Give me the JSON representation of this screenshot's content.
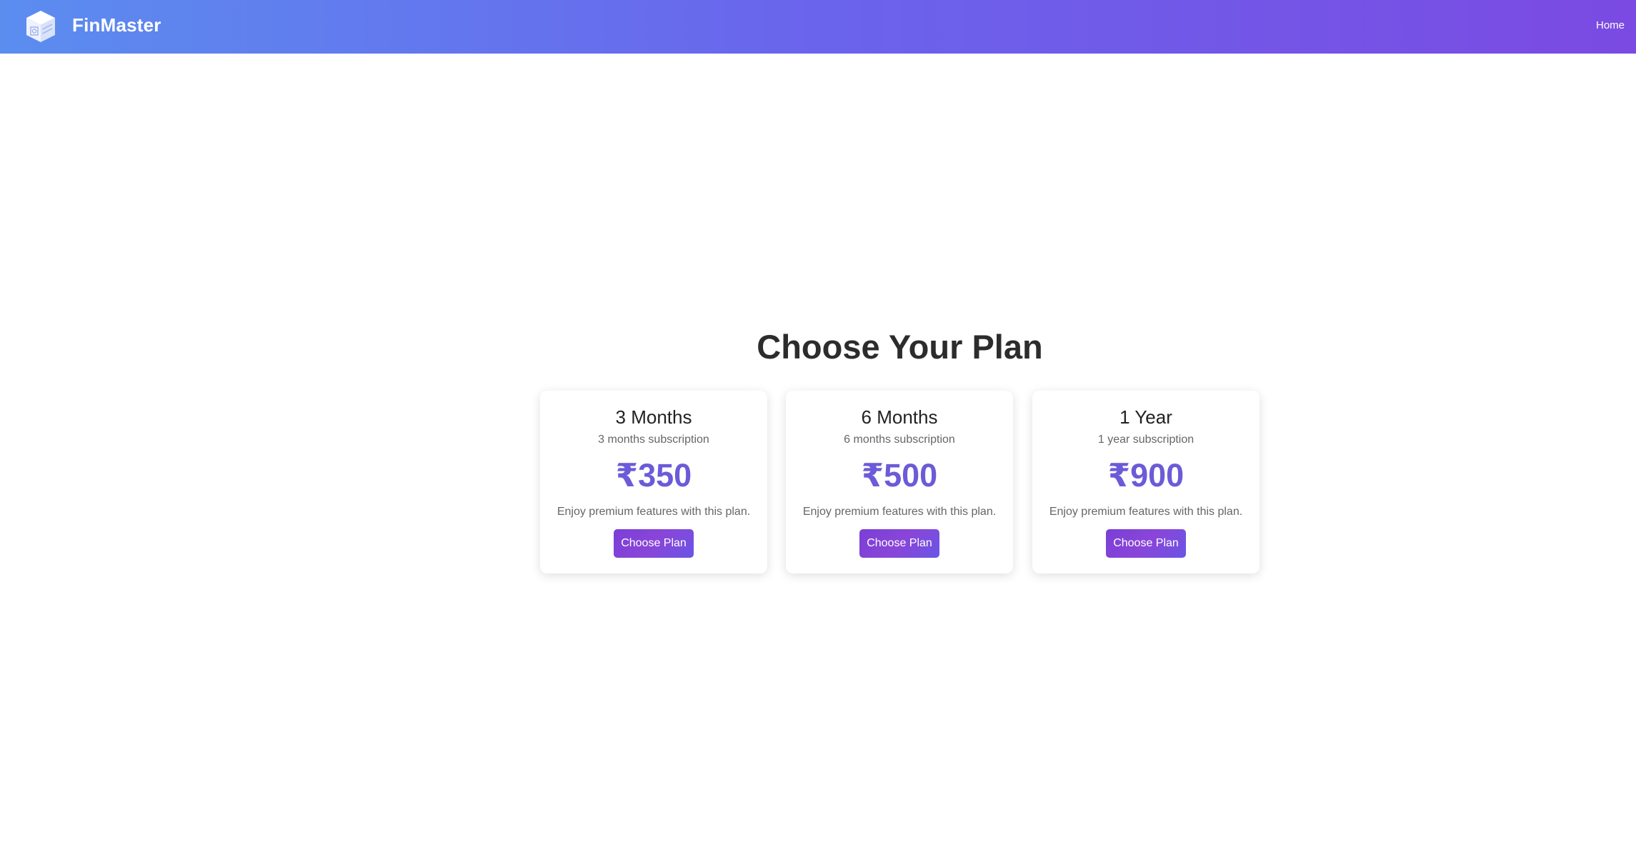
{
  "navbar": {
    "brand": "FinMaster",
    "home_link": "Home",
    "logo_icon": "cube-box-icon"
  },
  "main": {
    "title": "Choose Your Plan"
  },
  "plans": [
    {
      "title": "3 Months",
      "subtitle": "3 months subscription",
      "price": "₹350",
      "description": "Enjoy premium features with this plan.",
      "button_label": "Choose Plan"
    },
    {
      "title": "6 Months",
      "subtitle": "6 months subscription",
      "price": "₹500",
      "description": "Enjoy premium features with this plan.",
      "button_label": "Choose Plan"
    },
    {
      "title": "1 Year",
      "subtitle": "1 year subscription",
      "price": "₹900",
      "description": "Enjoy premium features with this plan.",
      "button_label": "Choose Plan"
    }
  ],
  "colors": {
    "navbar_gradient_start": "#5b8def",
    "navbar_gradient_end": "#7b4ae2",
    "price": "#6b5bd8",
    "button": "#7a3fd6"
  }
}
